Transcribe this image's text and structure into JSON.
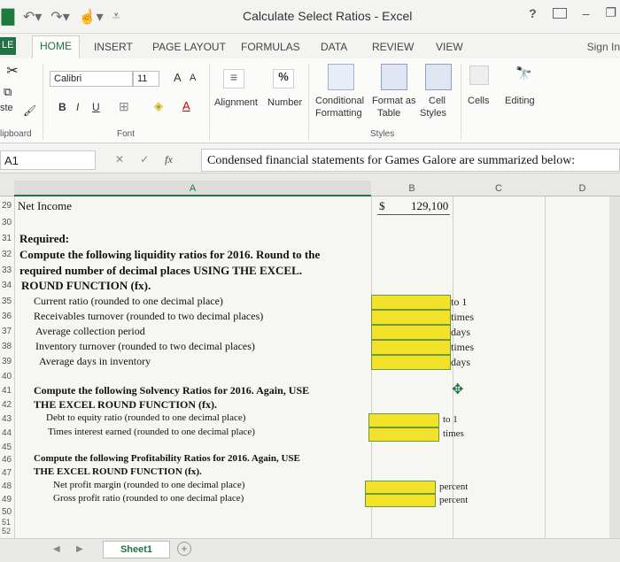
{
  "window": {
    "title": "Calculate Select Ratios - Excel",
    "help": "?",
    "sign_in": "Sign In"
  },
  "tabs": {
    "file": "LE",
    "items": [
      "HOME",
      "INSERT",
      "PAGE LAYOUT",
      "FORMULAS",
      "DATA",
      "REVIEW",
      "VIEW"
    ],
    "active": "HOME"
  },
  "ribbon": {
    "font_name": "Calibri",
    "font_size": "11",
    "grow": "A",
    "shrink": "A",
    "bold": "B",
    "italic": "I",
    "underline": "U",
    "font_color": "A",
    "alignment": "Alignment",
    "number": "Number",
    "percent": "%",
    "conditional_1": "Conditional",
    "conditional_2": "Formatting",
    "format_as_1": "Format as",
    "format_as_2": "Table",
    "cell_styles_1": "Cell",
    "cell_styles_2": "Styles",
    "cells": "Cells",
    "editing": "Editing",
    "paste": "ste",
    "group_clipboard": "lipboard",
    "group_font": "Font",
    "group_styles": "Styles"
  },
  "formula_bar": {
    "name_box": "A1",
    "cancel": "✕",
    "enter": "✓",
    "fx": "fx",
    "content": "Condensed financial statements for Games Galore are summarized below:"
  },
  "columns": [
    "A",
    "B",
    "C",
    "D"
  ],
  "rows": [
    {
      "n": "29",
      "a": "Net Income",
      "b_prefix": "$",
      "b": "129,100"
    },
    {
      "n": "30",
      "a": ""
    },
    {
      "n": "31",
      "a": "Required:",
      "bold": true
    },
    {
      "n": "32",
      "a": "Compute the following liquidity ratios for 2016. Round to the",
      "bold": true
    },
    {
      "n": "33",
      "a": "required number of decimal places USING THE EXCEL.",
      "bold": true
    },
    {
      "n": "34",
      "a": "ROUND FUNCTION (fx).",
      "bold": true
    },
    {
      "n": "35",
      "a": "Current ratio (rounded to one decimal place)",
      "unit": "to 1"
    },
    {
      "n": "36",
      "a": "Receivables turnover (rounded to two decimal places)",
      "unit": "times"
    },
    {
      "n": "37",
      "a": "Average collection period",
      "unit": "days"
    },
    {
      "n": "38",
      "a": "Inventory turnover (rounded to two decimal places)",
      "unit": "times"
    },
    {
      "n": "39",
      "a": "Average days in inventory",
      "unit": "days"
    },
    {
      "n": "40",
      "a": ""
    },
    {
      "n": "41",
      "a": "Compute the following Solvency Ratios for 2016. Again, USE",
      "bold": true
    },
    {
      "n": "42",
      "a": "THE EXCEL ROUND FUNCTION (fx).",
      "bold": true
    },
    {
      "n": "43",
      "a": "Debt to equity ratio (rounded to one decimal place)",
      "unit": "to 1"
    },
    {
      "n": "44",
      "a": "Times interest earned (rounded to one decimal place)",
      "unit": "times"
    },
    {
      "n": "45",
      "a": ""
    },
    {
      "n": "46",
      "a": "Compute the following Profitability Ratios for 2016. Again, USE",
      "bold": true
    },
    {
      "n": "47",
      "a": "THE EXCEL ROUND FUNCTION (fx).",
      "bold": true
    },
    {
      "n": "48",
      "a": "Net profit margin (rounded to one decimal place)",
      "unit": "percent"
    },
    {
      "n": "49",
      "a": "Gross profit ratio (rounded to one decimal place)",
      "unit": "percent"
    },
    {
      "n": "50",
      "a": ""
    },
    {
      "n": "51",
      "a": ""
    },
    {
      "n": "52",
      "a": ""
    }
  ],
  "sheet_tab": "Sheet1",
  "add_sheet": "+",
  "cursor_glyph": "✥",
  "colors": {
    "excel_green": "#217346",
    "input_yellow": "#f2e22a"
  }
}
